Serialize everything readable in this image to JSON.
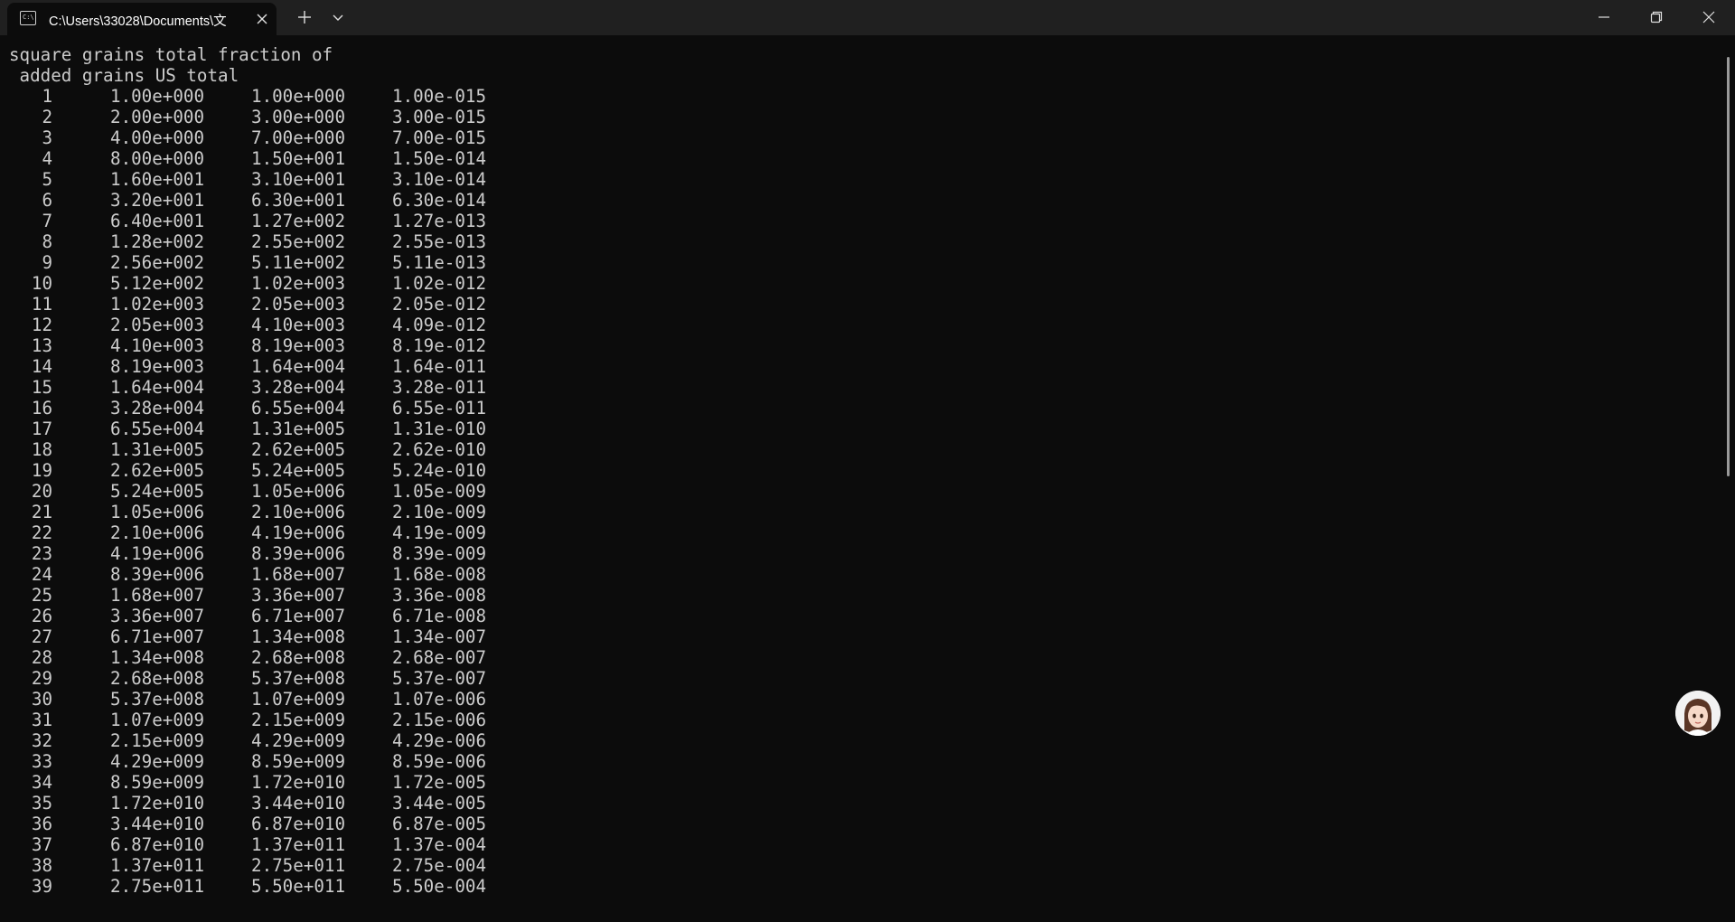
{
  "window": {
    "tab_title": "C:\\Users\\33028\\Documents\\文",
    "tab_icon": "terminal-icon",
    "icons": {
      "close_tab": "close-icon",
      "new_tab": "plus-icon",
      "dropdown": "chevron-down-icon",
      "minimize": "minimize-icon",
      "maximize": "restore-icon",
      "close_window": "close-icon"
    }
  },
  "terminal": {
    "header_line1": "square grains total fraction of",
    "header_line2": " added grains US total",
    "rows": [
      {
        "square": "1",
        "added": "1.00e+000",
        "total": "1.00e+000",
        "fraction": "1.00e-015"
      },
      {
        "square": "2",
        "added": "2.00e+000",
        "total": "3.00e+000",
        "fraction": "3.00e-015"
      },
      {
        "square": "3",
        "added": "4.00e+000",
        "total": "7.00e+000",
        "fraction": "7.00e-015"
      },
      {
        "square": "4",
        "added": "8.00e+000",
        "total": "1.50e+001",
        "fraction": "1.50e-014"
      },
      {
        "square": "5",
        "added": "1.60e+001",
        "total": "3.10e+001",
        "fraction": "3.10e-014"
      },
      {
        "square": "6",
        "added": "3.20e+001",
        "total": "6.30e+001",
        "fraction": "6.30e-014"
      },
      {
        "square": "7",
        "added": "6.40e+001",
        "total": "1.27e+002",
        "fraction": "1.27e-013"
      },
      {
        "square": "8",
        "added": "1.28e+002",
        "total": "2.55e+002",
        "fraction": "2.55e-013"
      },
      {
        "square": "9",
        "added": "2.56e+002",
        "total": "5.11e+002",
        "fraction": "5.11e-013"
      },
      {
        "square": "10",
        "added": "5.12e+002",
        "total": "1.02e+003",
        "fraction": "1.02e-012"
      },
      {
        "square": "11",
        "added": "1.02e+003",
        "total": "2.05e+003",
        "fraction": "2.05e-012"
      },
      {
        "square": "12",
        "added": "2.05e+003",
        "total": "4.10e+003",
        "fraction": "4.09e-012"
      },
      {
        "square": "13",
        "added": "4.10e+003",
        "total": "8.19e+003",
        "fraction": "8.19e-012"
      },
      {
        "square": "14",
        "added": "8.19e+003",
        "total": "1.64e+004",
        "fraction": "1.64e-011"
      },
      {
        "square": "15",
        "added": "1.64e+004",
        "total": "3.28e+004",
        "fraction": "3.28e-011"
      },
      {
        "square": "16",
        "added": "3.28e+004",
        "total": "6.55e+004",
        "fraction": "6.55e-011"
      },
      {
        "square": "17",
        "added": "6.55e+004",
        "total": "1.31e+005",
        "fraction": "1.31e-010"
      },
      {
        "square": "18",
        "added": "1.31e+005",
        "total": "2.62e+005",
        "fraction": "2.62e-010"
      },
      {
        "square": "19",
        "added": "2.62e+005",
        "total": "5.24e+005",
        "fraction": "5.24e-010"
      },
      {
        "square": "20",
        "added": "5.24e+005",
        "total": "1.05e+006",
        "fraction": "1.05e-009"
      },
      {
        "square": "21",
        "added": "1.05e+006",
        "total": "2.10e+006",
        "fraction": "2.10e-009"
      },
      {
        "square": "22",
        "added": "2.10e+006",
        "total": "4.19e+006",
        "fraction": "4.19e-009"
      },
      {
        "square": "23",
        "added": "4.19e+006",
        "total": "8.39e+006",
        "fraction": "8.39e-009"
      },
      {
        "square": "24",
        "added": "8.39e+006",
        "total": "1.68e+007",
        "fraction": "1.68e-008"
      },
      {
        "square": "25",
        "added": "1.68e+007",
        "total": "3.36e+007",
        "fraction": "3.36e-008"
      },
      {
        "square": "26",
        "added": "3.36e+007",
        "total": "6.71e+007",
        "fraction": "6.71e-008"
      },
      {
        "square": "27",
        "added": "6.71e+007",
        "total": "1.34e+008",
        "fraction": "1.34e-007"
      },
      {
        "square": "28",
        "added": "1.34e+008",
        "total": "2.68e+008",
        "fraction": "2.68e-007"
      },
      {
        "square": "29",
        "added": "2.68e+008",
        "total": "5.37e+008",
        "fraction": "5.37e-007"
      },
      {
        "square": "30",
        "added": "5.37e+008",
        "total": "1.07e+009",
        "fraction": "1.07e-006"
      },
      {
        "square": "31",
        "added": "1.07e+009",
        "total": "2.15e+009",
        "fraction": "2.15e-006"
      },
      {
        "square": "32",
        "added": "2.15e+009",
        "total": "4.29e+009",
        "fraction": "4.29e-006"
      },
      {
        "square": "33",
        "added": "4.29e+009",
        "total": "8.59e+009",
        "fraction": "8.59e-006"
      },
      {
        "square": "34",
        "added": "8.59e+009",
        "total": "1.72e+010",
        "fraction": "1.72e-005"
      },
      {
        "square": "35",
        "added": "1.72e+010",
        "total": "3.44e+010",
        "fraction": "3.44e-005"
      },
      {
        "square": "36",
        "added": "3.44e+010",
        "total": "6.87e+010",
        "fraction": "6.87e-005"
      },
      {
        "square": "37",
        "added": "6.87e+010",
        "total": "1.37e+011",
        "fraction": "1.37e-004"
      },
      {
        "square": "38",
        "added": "1.37e+011",
        "total": "2.75e+011",
        "fraction": "2.75e-004"
      },
      {
        "square": "39",
        "added": "2.75e+011",
        "total": "5.50e+011",
        "fraction": "5.50e-004"
      }
    ]
  },
  "colors": {
    "terminal_bg": "#0c0c0c",
    "terminal_fg": "#cccccc",
    "titlebar_bg": "#202020"
  },
  "floating_assistant": {
    "icon": "assistant-avatar-icon"
  }
}
